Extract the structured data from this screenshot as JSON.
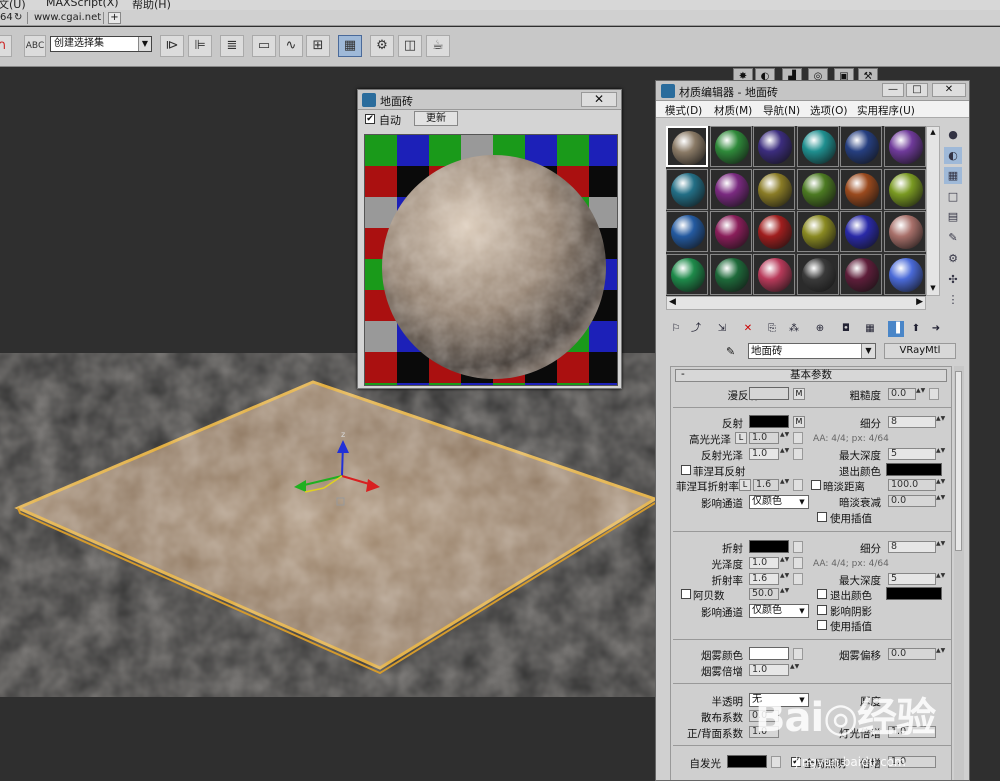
{
  "menubar": {
    "items": [
      "文(U)",
      "MAXScript(X)",
      "帮助(H)"
    ]
  },
  "urlbar": {
    "prefix": "64",
    "url": "www.cgai.net",
    "plus": "+"
  },
  "toolbar": {
    "selection_set": "创建选择集",
    "abc": "ABC"
  },
  "preview_window": {
    "title": "地面砖",
    "auto_label": "自动",
    "auto_checked": "✔",
    "update_button": "更新",
    "close": "✕"
  },
  "material_editor": {
    "title": "材质编辑器 - 地面砖",
    "window_buttons": {
      "minimize": "—",
      "restore": "□",
      "close": "✕"
    },
    "menu": [
      "模式(D)",
      "材质(M)",
      "导航(N)",
      "选项(O)",
      "实用程序(U)"
    ],
    "material_name": "地面砖",
    "material_type": "VRayMtl",
    "slot_colors": [
      "#8a7a66",
      "#2f8a3a",
      "#3c2d7e",
      "#1f8f8f",
      "#263f80",
      "#6f3a9a",
      "#236f86",
      "#7a2a80",
      "#8a7c26",
      "#4c7a22",
      "#9a4a1e",
      "#7a9a22",
      "#245aa0",
      "#8a1e5a",
      "#a01e1e",
      "#8a8a22",
      "#2a2aa8",
      "#a8706a",
      "#1e8a4a",
      "#1e6a3a",
      "#b83a5a",
      "#3a3a3a",
      "#5e1e3a",
      "#4a6ad8"
    ],
    "basic_params": {
      "rollout_title": "基本参数",
      "collapse": "-",
      "diffuse_label": "漫反射",
      "roughness_label": "粗糙度",
      "roughness_value": "0.0",
      "diffuse_color": "#d6d6d6",
      "m": "M",
      "reflect_label": "反射",
      "reflect_color": "#000000",
      "hilight_gloss_label": "高光光泽",
      "hilight_gloss_value": "1.0",
      "l": "L",
      "refl_gloss_label": "反射光泽",
      "refl_gloss_value": "1.0",
      "fresnel_label": "菲涅耳反射",
      "fresnel_ior_label": "菲涅耳折射率",
      "fresnel_ior_value": "1.6",
      "subdivs_label": "细分",
      "subdivs_value": "8",
      "aa_info": "AA: 4/4; px: 4/64",
      "max_depth_label": "最大深度",
      "max_depth_value": "5",
      "exit_color_label": "退出颜色",
      "exit_color": "#000000",
      "dim_dist_label": "暗淡距离",
      "dim_dist_value": "100.0",
      "dim_falloff_label": "暗淡衰减",
      "dim_falloff_value": "0.0",
      "affect_channels_label": "影响通道",
      "affect_channels_value": "仅颜色",
      "use_interp_label": "使用插值",
      "refract_label": "折射",
      "refract_color": "#000000",
      "gloss_label": "光泽度",
      "gloss_value": "1.0",
      "ior_label": "折射率",
      "ior_value": "1.6",
      "abbe_label": "阿贝数",
      "abbe_value": "50.0",
      "refr_subdivs_value": "8",
      "refr_aa_info": "AA: 4/4; px: 4/64",
      "refr_max_depth_value": "5",
      "refr_exit_color": "#000000",
      "affect_shadows_label": "影响阴影",
      "fog_color_label": "烟雾颜色",
      "fog_color": "#ffffff",
      "fog_mult_label": "烟雾倍增",
      "fog_mult_value": "1.0",
      "fog_bias_label": "烟雾偏移",
      "fog_bias_value": "0.0",
      "translucency_label": "半透明",
      "translucency_value": "无",
      "scatter_label": "散布系数",
      "scatter_value": "0.0",
      "fb_label": "正/背面系数",
      "fb_value": "1.0",
      "light_mult_label": "灯光倍增",
      "light_mult_value": "1.0",
      "thickness_label": "厚度",
      "self_illum_label": "自发光",
      "self_illum_color": "#000000",
      "gi_label": "全局照明",
      "gi_checked": "✔",
      "mult_label": "倍增",
      "mult_value": "1.0"
    }
  },
  "watermark": {
    "logo": "Bai◎经验",
    "url": "jingyan.baidu.com"
  }
}
